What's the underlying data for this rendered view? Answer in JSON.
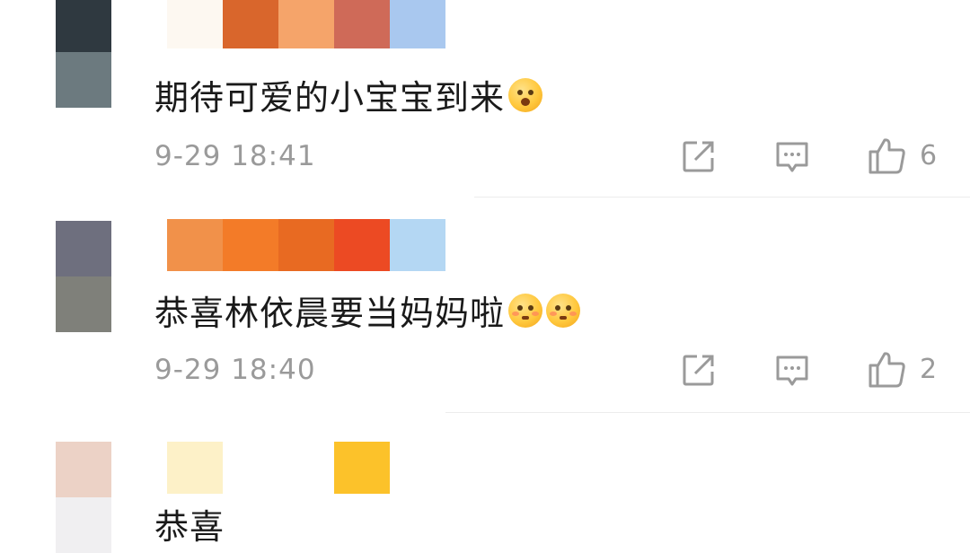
{
  "comments": [
    {
      "avatar_colors": [
        "#2f3940",
        "#6c7a7f"
      ],
      "username_colors": [
        "#fdf8f1",
        "#d9662c",
        "#f5a46a",
        "#cf6a58",
        "#a9c8ef"
      ],
      "text": "期待可爱的小宝宝到来",
      "emojis": [
        "surprised-face"
      ],
      "time": "9-29 18:41",
      "like_count": "6"
    },
    {
      "avatar_colors": [
        "#6e6f7e",
        "#7f807a"
      ],
      "username_colors": [
        "#f1914a",
        "#f37b28",
        "#e86a22",
        "#ec4a23",
        "#b4d7f3"
      ],
      "text": "恭喜林依晨要当妈妈啦",
      "emojis": [
        "blushing-face",
        "blushing-face"
      ],
      "time": "9-29 18:40",
      "like_count": "2"
    },
    {
      "avatar_colors": [
        "#ecd2c6",
        "#f0eff1"
      ],
      "username_colors": [
        "#fdf1c8",
        "#ffffff",
        "#ffffff",
        "#fcc22a"
      ],
      "text": "恭喜",
      "emojis": []
    }
  ],
  "icons": {
    "repost": "repost-icon",
    "reply": "comment-icon",
    "like": "thumbs-up-icon"
  },
  "colors": {
    "text": "#1a1a1a",
    "meta": "#9a9a9a",
    "divider": "#ececec"
  }
}
